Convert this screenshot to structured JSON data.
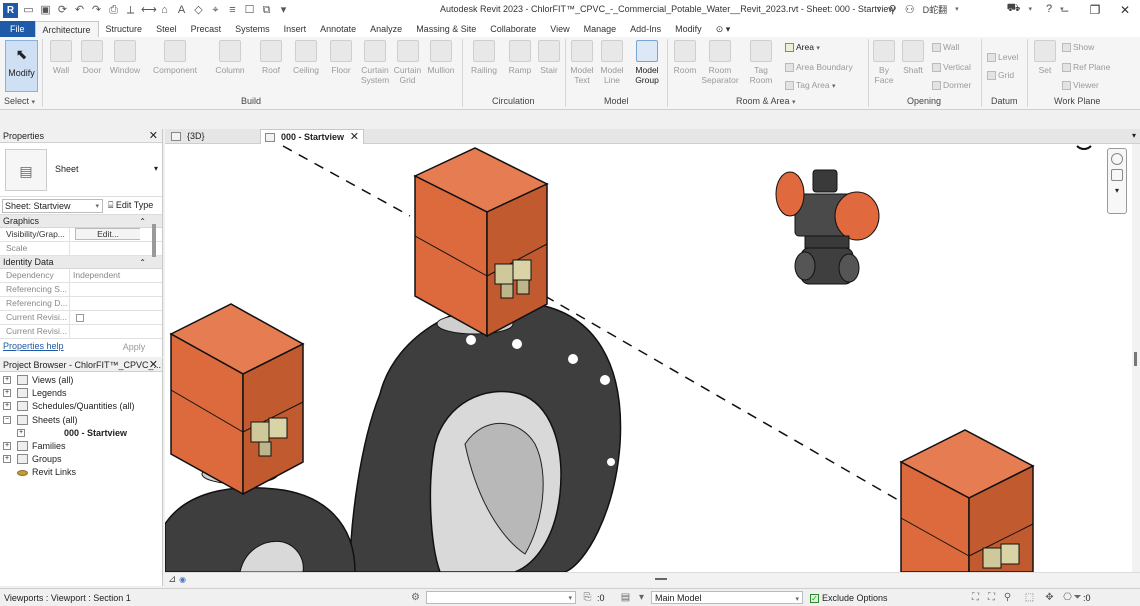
{
  "app": {
    "logo": "R",
    "title": "Autodesk Revit 2023 - ChlorFIT™_CPVC_-_Commercial_Potable_Water__Revit_2023.rvt - Sheet: 000 - Startview",
    "user": "D蛇翻",
    "help_icon": "?"
  },
  "ribbon_tabs": [
    "File",
    "Architecture",
    "Structure",
    "Steel",
    "Precast",
    "Systems",
    "Insert",
    "Annotate",
    "Analyze",
    "Massing & Site",
    "Collaborate",
    "View",
    "Manage",
    "Add-Ins",
    "Modify"
  ],
  "active_tab": "Architecture",
  "ribbon": {
    "modify": "Modify",
    "select": "Select",
    "build": {
      "label": "Build",
      "tools": [
        "Wall",
        "Door",
        "Window",
        "Component",
        "Column",
        "Roof",
        "Ceiling",
        "Floor",
        "Curtain System",
        "Curtain Grid",
        "Mullion"
      ]
    },
    "circulation": {
      "label": "Circulation",
      "tools": [
        "Railing",
        "Ramp",
        "Stair"
      ]
    },
    "model": {
      "label": "Model",
      "tools": [
        "Model Text",
        "Model Line",
        "Model Group"
      ]
    },
    "room_area": {
      "label": "Room & Area",
      "tools": [
        "Room",
        "Room Separator",
        "Tag Room"
      ],
      "area": "Area",
      "area_boundary": "Area  Boundary",
      "tag_area": "Tag  Area"
    },
    "opening": {
      "label": "Opening",
      "by_face": "By Face",
      "shaft": "Shaft",
      "wall": "Wall",
      "vertical": "Vertical",
      "dormer": "Dormer"
    },
    "datum": {
      "label": "Datum",
      "level": "Level",
      "grid": "Grid"
    },
    "work_plane": {
      "label": "Work Plane",
      "set": "Set",
      "show": "Show",
      "ref_plane": "Ref  Plane",
      "viewer": "Viewer"
    }
  },
  "properties": {
    "title": "Properties",
    "type_name": "Sheet",
    "instance_selector": "Sheet: Startview",
    "edit_type": "Edit Type",
    "groups": [
      {
        "name": "Graphics",
        "rows": [
          {
            "key": "Visibility/Grap...",
            "value": "Edit..."
          },
          {
            "key": "Scale",
            "value": ""
          }
        ]
      },
      {
        "name": "Identity Data",
        "rows": [
          {
            "key": "Dependency",
            "value": "Independent"
          },
          {
            "key": "Referencing S...",
            "value": ""
          },
          {
            "key": "Referencing D...",
            "value": ""
          },
          {
            "key": "Current Revisi...",
            "value": ""
          },
          {
            "key": "Current Revisi...",
            "value": ""
          }
        ]
      }
    ],
    "help": "Properties help",
    "apply": "Apply"
  },
  "browser": {
    "title": "Project Browser - ChlorFIT™_CPVC_...",
    "nodes": [
      {
        "label": "Views (all)",
        "level": 1,
        "toggle": "+"
      },
      {
        "label": "Legends",
        "level": 1,
        "toggle": "+"
      },
      {
        "label": "Schedules/Quantities (all)",
        "level": 1,
        "toggle": "+"
      },
      {
        "label": "Sheets (all)",
        "level": 1,
        "toggle": "−"
      },
      {
        "label": "000 - Startview",
        "level": 2,
        "toggle": "+"
      },
      {
        "label": "Families",
        "level": 1,
        "toggle": "+"
      },
      {
        "label": "Groups",
        "level": 1,
        "toggle": "+"
      },
      {
        "label": "Revit Links",
        "level": 1,
        "toggle": ""
      }
    ]
  },
  "view_tabs": [
    {
      "label": "{3D}",
      "active": false
    },
    {
      "label": "000 - Startview",
      "active": true
    }
  ],
  "status": {
    "text": "Viewports : Viewport : Section 1",
    "zero": ":0",
    "workset": "Main Model",
    "exclude_options": "Exclude Options",
    "filter": ":0"
  },
  "colors": {
    "accent": "#1f5aa8",
    "actuator_orange": "#e06a3e",
    "valve_body": "#3e3e3e",
    "terminal": "#cfc89a"
  },
  "icons": {
    "search": "search-icon",
    "user": "user-icon",
    "cart": "cart-icon",
    "help": "help-icon",
    "close": "close-icon"
  }
}
